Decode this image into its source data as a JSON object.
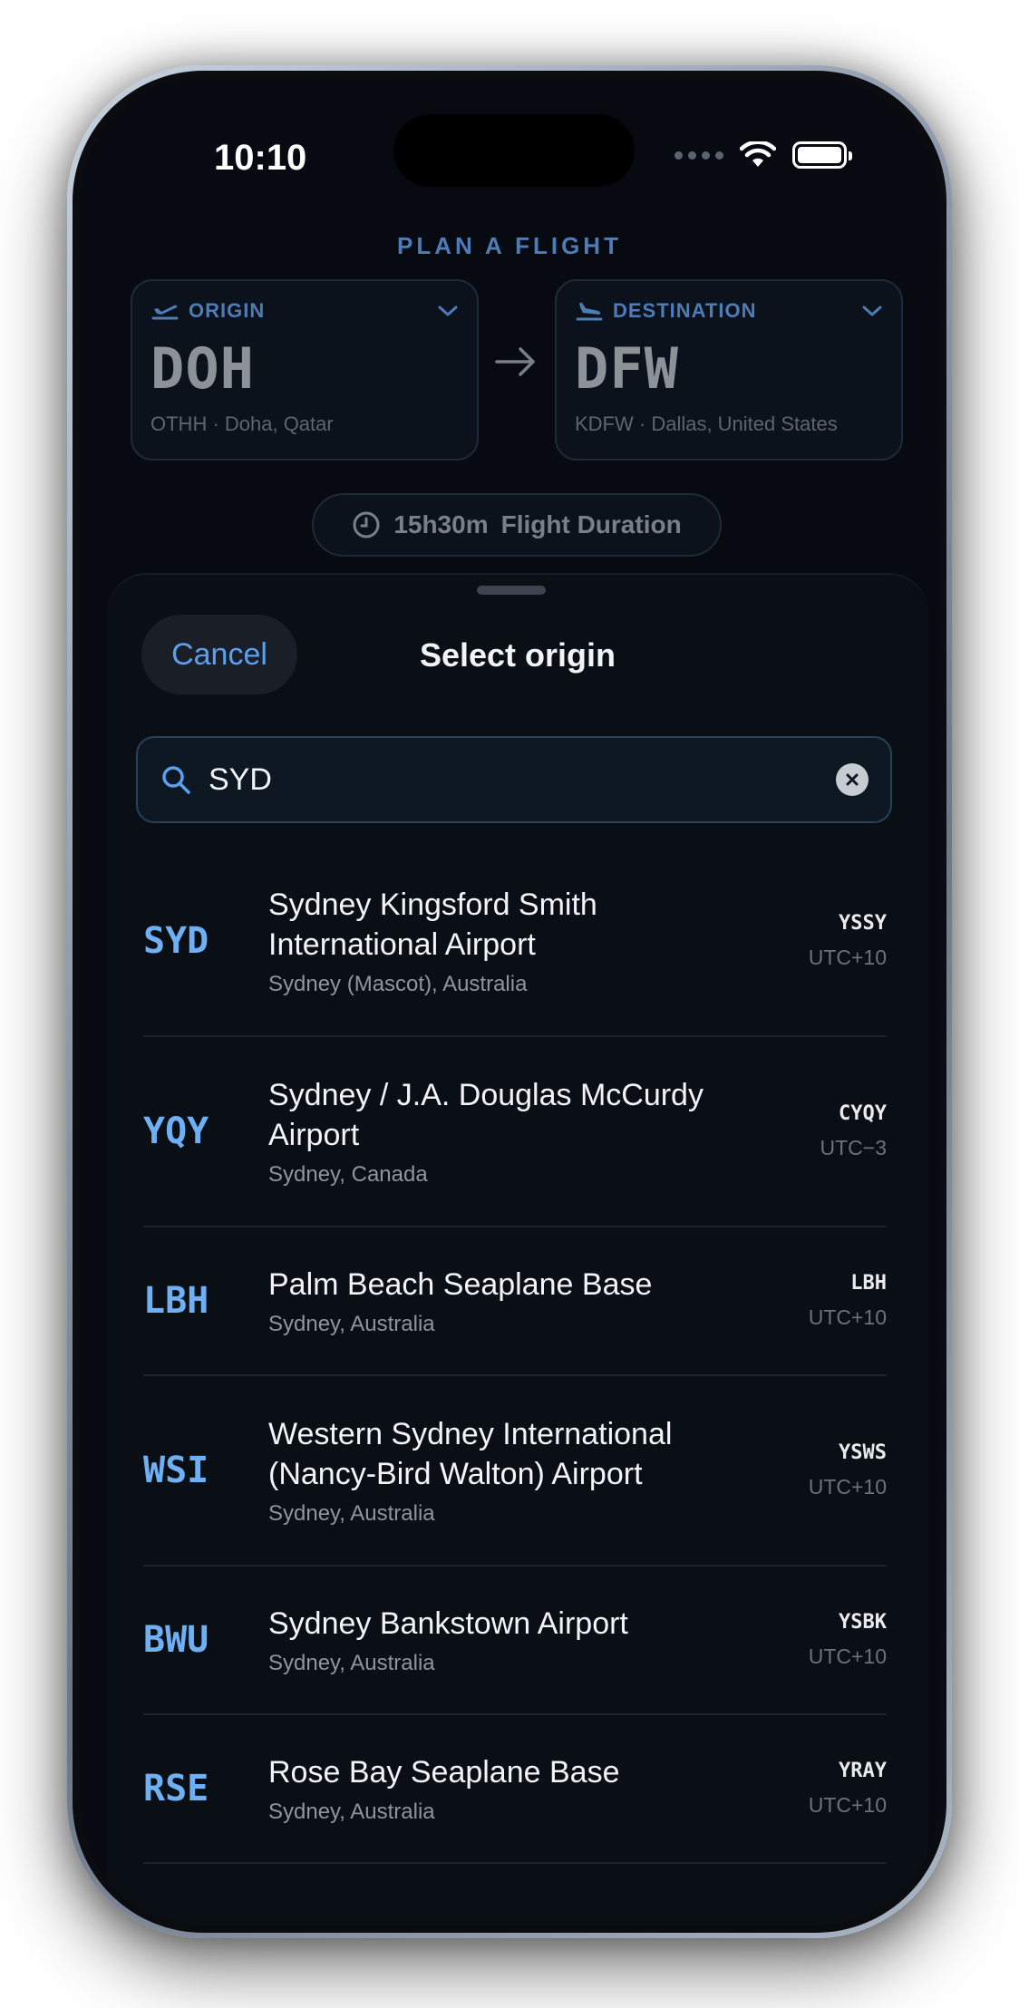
{
  "status": {
    "time": "10:10"
  },
  "header": {
    "title": "PLAN A FLIGHT"
  },
  "origin": {
    "label": "ORIGIN",
    "code": "DOH",
    "sub": "OTHH · Doha, Qatar"
  },
  "destination": {
    "label": "DESTINATION",
    "code": "DFW",
    "sub": "KDFW · Dallas, United States"
  },
  "duration": {
    "value": "15h30m",
    "label": "Flight Duration"
  },
  "sheet": {
    "cancel": "Cancel",
    "title": "Select origin",
    "search_value": "SYD"
  },
  "results": [
    {
      "iata": "SYD",
      "name": "Sydney Kingsford Smith International Airport",
      "place": "Sydney (Mascot), Australia",
      "icao": "YSSY",
      "tz": "UTC+10"
    },
    {
      "iata": "YQY",
      "name": "Sydney / J.A. Douglas McCurdy Airport",
      "place": "Sydney, Canada",
      "icao": "CYQY",
      "tz": "UTC−3"
    },
    {
      "iata": "LBH",
      "name": "Palm Beach Seaplane Base",
      "place": "Sydney, Australia",
      "icao": "LBH",
      "tz": "UTC+10"
    },
    {
      "iata": "WSI",
      "name": "Western Sydney International (Nancy-Bird Walton) Airport",
      "place": "Sydney, Australia",
      "icao": "YSWS",
      "tz": "UTC+10"
    },
    {
      "iata": "BWU",
      "name": "Sydney Bankstown Airport",
      "place": "Sydney, Australia",
      "icao": "YSBK",
      "tz": "UTC+10"
    },
    {
      "iata": "RSE",
      "name": "Rose Bay Seaplane Base",
      "place": "Sydney, Australia",
      "icao": "YRAY",
      "tz": "UTC+10"
    }
  ]
}
